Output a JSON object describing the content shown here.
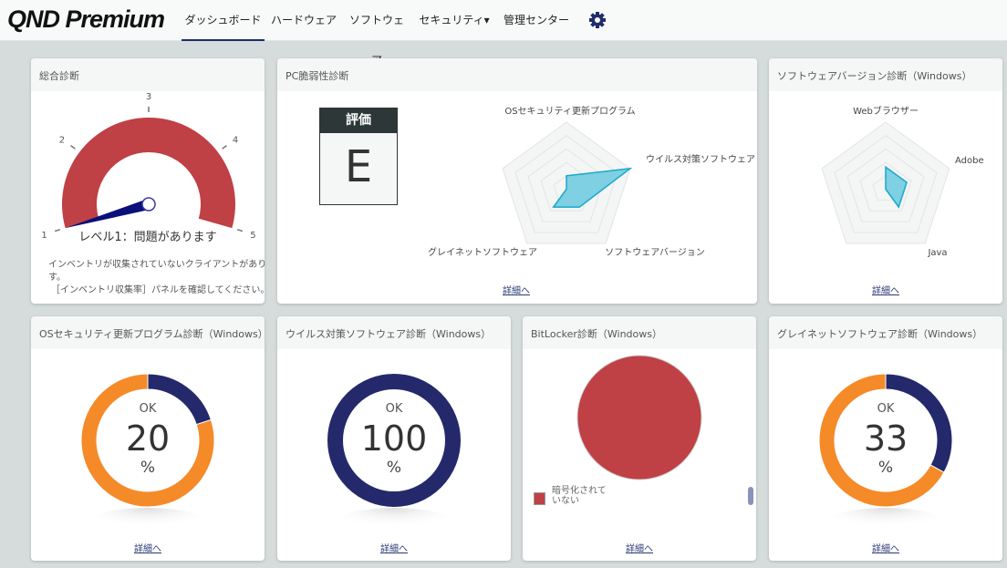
{
  "header": {
    "logo": "QND Premium",
    "nav": [
      {
        "label": "ダッシュボード",
        "active": true
      },
      {
        "label": "ハードウェア"
      },
      {
        "label": "ソフトウェア"
      },
      {
        "label": "セキュリティ▾"
      },
      {
        "label": "管理センター"
      }
    ],
    "settings_icon": "gear-icon"
  },
  "colors": {
    "accent": "#1f2d6b",
    "danger": "#bf4045",
    "orange": "#f58a29",
    "navy": "#23296a",
    "radar_fill": "#7ed0e2",
    "radar_stroke": "#17a9c9"
  },
  "panels": {
    "overall": {
      "title": "総合診断",
      "gauge": {
        "min": 1,
        "max": 5,
        "ticks": [
          "1",
          "2",
          "3",
          "4",
          "5"
        ],
        "value": 1
      },
      "level_text": "レベル1：問題があります",
      "message_line1": "インベントリが収集されていないクライアントがありま",
      "message_line2": "す。",
      "message_line3": "［インベントリ収集率］パネルを確認してください。"
    },
    "vulnerability": {
      "title": "PC脆弱性診断",
      "rating_label": "評価",
      "rating": "E",
      "radar": {
        "axes": [
          "OSセキュリティ更新プログラム",
          "ウイルス対策ソフトウェア",
          "ソフトウェアバージョン",
          "グレイネットソフトウェア",
          ""
        ],
        "values": [
          0.2,
          1.0,
          0.33,
          0.33,
          0
        ]
      },
      "link": "詳細へ"
    },
    "software_version": {
      "title": "ソフトウェアバージョン診断（Windows）",
      "radar": {
        "axes": [
          "Webブラウザー",
          "Adobe",
          "Java",
          "",
          ""
        ],
        "values": [
          0.33,
          0.33,
          0.33,
          0,
          0
        ]
      },
      "link": "詳細へ"
    },
    "os_update": {
      "title": "OSセキュリティ更新プログラム診断（Windows）",
      "ok_label": "OK",
      "value": "20",
      "percent": 20,
      "unit": "%",
      "link": "詳細へ"
    },
    "antivirus": {
      "title": "ウイルス対策ソフトウェア診断（Windows）",
      "ok_label": "OK",
      "value": "100",
      "percent": 100,
      "unit": "%",
      "link": "詳細へ"
    },
    "bitlocker": {
      "title": "BitLocker診断（Windows）",
      "legend_line1": "暗号化されて",
      "legend_line2": "いない",
      "slices": [
        {
          "label": "暗号化されていない",
          "value": 100
        }
      ],
      "link": "詳細へ"
    },
    "greynet": {
      "title": "グレイネットソフトウェア診断（Windows）",
      "ok_label": "OK",
      "value": "33",
      "percent": 33,
      "unit": "%",
      "link": "詳細へ"
    }
  }
}
